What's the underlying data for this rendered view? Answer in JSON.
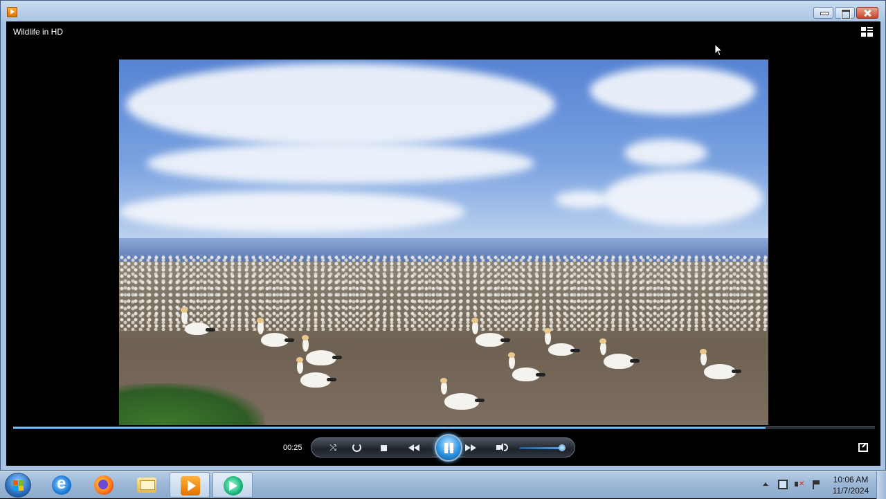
{
  "window": {
    "icon": "media-player-icon",
    "buttons": [
      "minimize",
      "maximize",
      "close"
    ]
  },
  "player": {
    "media_title": "Wildlife in HD",
    "elapsed_time": "00:25",
    "progress": 0.873,
    "volume_level": 0.86,
    "state": "playing",
    "controls": [
      "shuffle",
      "repeat",
      "stop",
      "previous",
      "pause",
      "next",
      "mute",
      "volume",
      "switch-to-library",
      "switch-to-now-playing"
    ]
  },
  "taskbar": {
    "start": "start-orb-icon",
    "apps": [
      "internet-explorer-icon",
      "firefox-icon",
      "file-explorer-icon",
      "windows-media-player-icon",
      "windows-media-center-icon"
    ],
    "active_app": "windows-media-player-icon",
    "clock_time": "10:06 AM",
    "clock_date": "11/7/2024"
  },
  "colors": {
    "accent": "#2b93e0",
    "titlebar": "#c9dcf0",
    "player_background": "#000000"
  }
}
